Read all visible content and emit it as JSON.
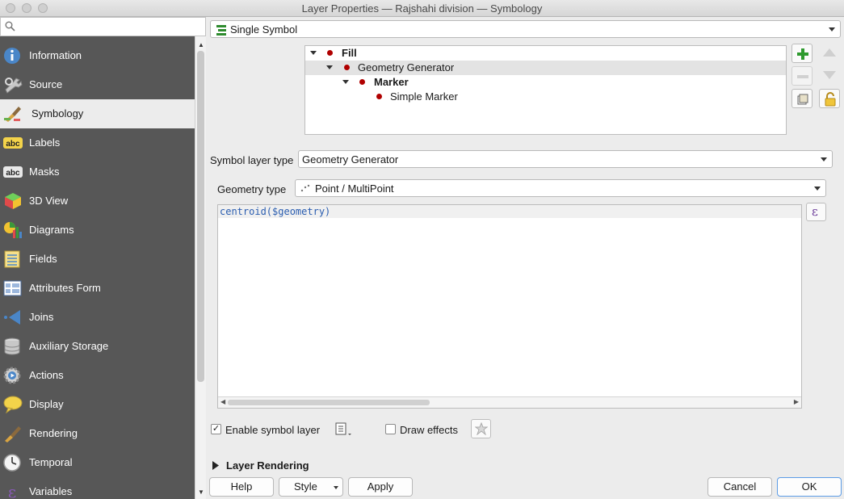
{
  "window": {
    "title": "Layer Properties — Rajshahi division — Symbology"
  },
  "search": {
    "placeholder": ""
  },
  "sidebar": {
    "items": [
      {
        "label": "Information",
        "icon": "info-icon"
      },
      {
        "label": "Source",
        "icon": "source-wrench-icon"
      },
      {
        "label": "Symbology",
        "icon": "paintbrush-icon",
        "active": true
      },
      {
        "label": "Labels",
        "icon": "abc-labels-icon"
      },
      {
        "label": "Masks",
        "icon": "abc-masks-icon"
      },
      {
        "label": "3D View",
        "icon": "cube-icon"
      },
      {
        "label": "Diagrams",
        "icon": "diagram-icon"
      },
      {
        "label": "Fields",
        "icon": "fields-icon"
      },
      {
        "label": "Attributes Form",
        "icon": "form-icon"
      },
      {
        "label": "Joins",
        "icon": "joins-icon"
      },
      {
        "label": "Auxiliary Storage",
        "icon": "database-icon"
      },
      {
        "label": "Actions",
        "icon": "actions-gear-icon"
      },
      {
        "label": "Display",
        "icon": "speech-bubble-icon"
      },
      {
        "label": "Rendering",
        "icon": "rendering-brush-icon"
      },
      {
        "label": "Temporal",
        "icon": "clock-icon"
      },
      {
        "label": "Variables",
        "icon": "epsilon-icon"
      }
    ]
  },
  "renderer": {
    "value": "Single Symbol"
  },
  "tree": {
    "rows": [
      {
        "label": "Fill",
        "bold": true
      },
      {
        "label": "Geometry Generator",
        "bold": false
      },
      {
        "label": "Marker",
        "bold": true
      },
      {
        "label": "Simple Marker",
        "bold": false
      }
    ]
  },
  "symbol_layer_type": {
    "label": "Symbol layer type",
    "value": "Geometry Generator"
  },
  "geometry_type": {
    "label": "Geometry type",
    "value": "Point / MultiPoint"
  },
  "expression": {
    "value": "centroid($geometry)"
  },
  "enable_symbol_layer": {
    "label": "Enable symbol layer",
    "checked": true
  },
  "draw_effects": {
    "label": "Draw effects",
    "checked": false
  },
  "layer_rendering": {
    "label": "Layer Rendering"
  },
  "buttons": {
    "help": "Help",
    "style": "Style",
    "apply": "Apply",
    "cancel": "Cancel",
    "ok": "OK"
  },
  "colors": {
    "sidebar_bg": "#575757",
    "accent_green": "#2e8b2e",
    "marker_red": "#b00000",
    "ok_border": "#5c9ce6"
  }
}
